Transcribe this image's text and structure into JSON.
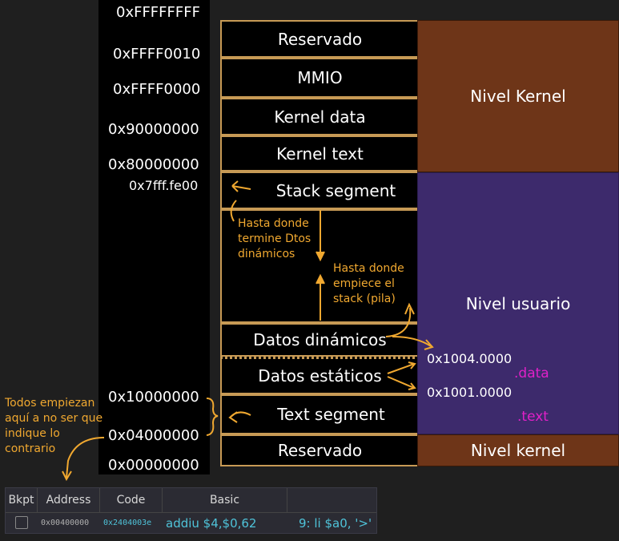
{
  "addresses": {
    "a_ffffffff": "0xFFFFFFFF",
    "a_ffff0010": "0xFFFF0010",
    "a_ffff0000": "0xFFFF0000",
    "a_90000000": "0x90000000",
    "a_80000000": "0x80000000",
    "a_7fff": "0x7fff.fe00",
    "a_10000000": "0x10000000",
    "a_04000000": "0x04000000",
    "a_00000000": "0x00000000"
  },
  "segments": {
    "reservado_top": "Reservado",
    "mmio": "MMIO",
    "kernel_data": "Kernel data",
    "kernel_text": "Kernel text",
    "stack": "Stack segment",
    "datos_dinamicos": "Datos dinámicos",
    "datos_estaticos": "Datos estáticos",
    "text_segment": "Text segment",
    "reservado_bottom": "Reservado"
  },
  "levels": {
    "kernel_top": "Nivel Kernel",
    "usuario": "Nivel usuario",
    "kernel_bottom": "Nivel kernel",
    "addr_1004": "0x1004.0000",
    "addr_1001": "0x1001.0000",
    "data_label": ".data",
    "text_label": ".text"
  },
  "annotations": {
    "hasta_dtos": [
      "Hasta donde",
      "termine Dtos",
      "dinámicos"
    ],
    "hasta_stack": [
      "Hasta donde",
      "empiece el",
      "stack (pila)"
    ],
    "todos": [
      "Todos empiezan",
      "aquí a no ser que",
      "indique lo",
      "contrario"
    ]
  },
  "colors": {
    "border": "#c79a55",
    "kernel": "#6e3518",
    "usuario": "#3d2a6c",
    "annotation": "#f0a830",
    "section_label": "#e020c8"
  },
  "table": {
    "headers": [
      "Bkpt",
      "Address",
      "Code",
      "Basic",
      ""
    ],
    "row": {
      "address": "0x00400000",
      "code": "0x2404003e",
      "basic": "addiu $4,$0,62",
      "source": "9: li $a0, '>'"
    }
  }
}
